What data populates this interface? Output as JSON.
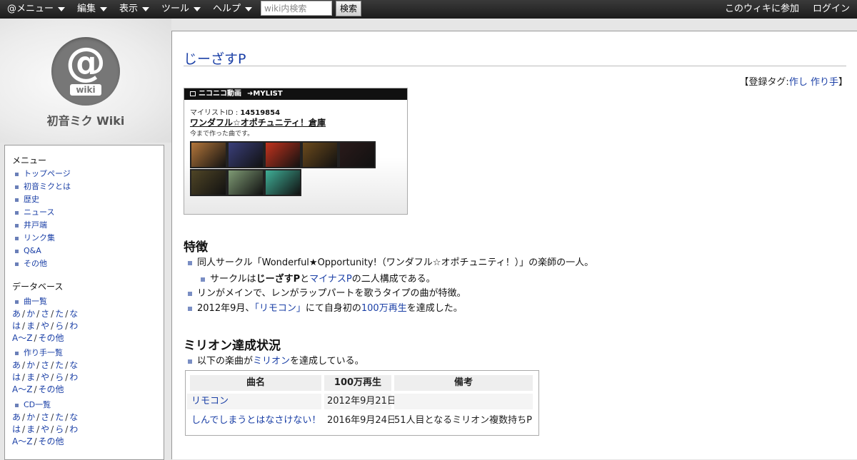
{
  "topbar": {
    "menus": [
      "@メニュー",
      "編集",
      "表示",
      "ツール",
      "ヘルプ"
    ],
    "search_placeholder": "wiki内検索",
    "search_button": "検索",
    "join": "このウィキに参加",
    "login": "ログイン"
  },
  "site": {
    "logo_text": "@",
    "logo_sub": "wiki",
    "title": "初音ミク Wiki"
  },
  "sidebar": {
    "menu_heading": "メニュー",
    "menu_items": [
      "トップページ",
      "初音ミクとは",
      "歴史",
      "ニュース",
      "井戸端",
      "リンク集",
      "Q&A",
      "その他"
    ],
    "db_heading": "データベース",
    "sections": [
      {
        "label": "曲一覧",
        "rows": [
          [
            "あ",
            "か",
            "さ",
            "た",
            "な"
          ],
          [
            "は",
            "ま",
            "や",
            "ら",
            "わ"
          ],
          [
            "A～Z",
            "その他"
          ]
        ]
      },
      {
        "label": "作り手一覧",
        "rows": [
          [
            "あ",
            "か",
            "さ",
            "た",
            "な"
          ],
          [
            "は",
            "ま",
            "や",
            "ら",
            "わ"
          ],
          [
            "A～Z",
            "その他"
          ]
        ]
      },
      {
        "label": "CD一覧",
        "rows": [
          [
            "あ",
            "か",
            "さ",
            "た",
            "な"
          ],
          [
            "は",
            "ま",
            "や",
            "ら",
            "わ"
          ],
          [
            "A～Z",
            "その他"
          ]
        ]
      }
    ]
  },
  "page": {
    "title": "じーざすP",
    "tags_prefix": "【登録タグ:",
    "tags": [
      "作し",
      "作り手"
    ],
    "tags_suffix": "】"
  },
  "mylist": {
    "header_logo": "ニコニコ動画",
    "header_label": "MYLIST",
    "id_label": "マイリストID : ",
    "id": "14519854",
    "name": "ワンダフル☆オポチュニティ！倉庫",
    "description": "今まで作った曲です。",
    "thumb_colors": [
      "#b4763a",
      "#3a3f7a",
      "#c2331e",
      "#6b4a1c",
      "#2a1a1a",
      "#4f4526",
      "#7e9a74",
      "#3fae96"
    ]
  },
  "features": {
    "heading": "特徴",
    "b1": "同人サークル「Wonderful★Opportunity!（ワンダフル☆オポチュニティ！）」の楽師の一人。",
    "b2_pre": "サークルは",
    "b2_bold": "じーざすP",
    "b2_mid": "と",
    "b2_link": "マイナスP",
    "b2_post": "の二人構成である。",
    "b3": "リンがメインで、レンがラップパートを歌うタイプの曲が特徴。",
    "b4_pre": "2012年9月、",
    "b4_link1": "「リモコン」",
    "b4_mid": "にて自身初の",
    "b4_link2": "100万再生",
    "b4_post": "を達成した。"
  },
  "million": {
    "heading": "ミリオン達成状況",
    "intro_pre": "以下の楽曲が",
    "intro_link": "ミリオン",
    "intro_post": "を達成している。",
    "columns": [
      "曲名",
      "100万再生",
      "備考"
    ],
    "rows": [
      {
        "song": "リモコン",
        "date": "2012年9月21日",
        "note": ""
      },
      {
        "song": "しんでしまうとはなさけない！",
        "date": "2016年9月24日",
        "note": "51人目となるミリオン複数持ちP"
      }
    ]
  }
}
